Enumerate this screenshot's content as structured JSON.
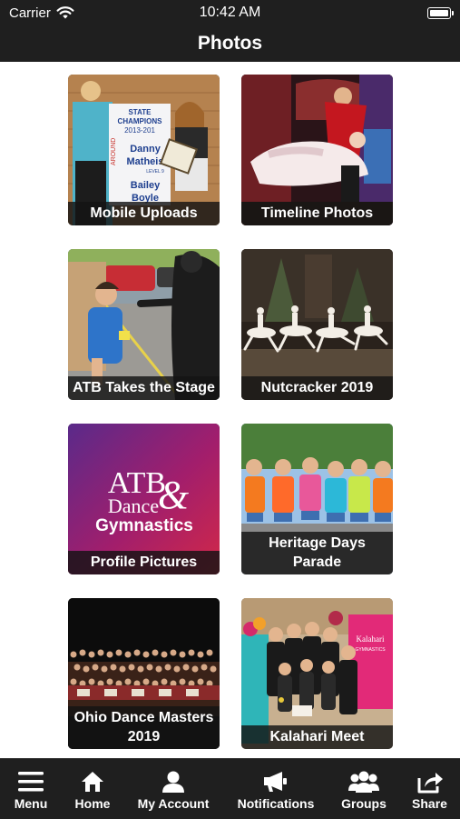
{
  "status_bar": {
    "carrier": "Carrier",
    "time": "10:42 AM",
    "wifi_icon": "wifi-icon",
    "battery_icon": "battery-icon"
  },
  "header": {
    "title": "Photos"
  },
  "albums": [
    {
      "caption": "Mobile Uploads",
      "sign_text": [
        "STATE",
        "CHAMPIONS",
        "2013-201",
        "Danny",
        "Matheis",
        "Bailey",
        "Boyle",
        "AROUND",
        "LEVEL 9"
      ]
    },
    {
      "caption": "Timeline Photos"
    },
    {
      "caption": "ATB Takes the Stage"
    },
    {
      "caption": "Nutcracker 2019"
    },
    {
      "caption": "Profile Pictures",
      "logo_text": [
        "ATB",
        "Dance",
        "Gymnastics"
      ]
    },
    {
      "caption": "Heritage Days Parade"
    },
    {
      "caption": "Ohio Dance Masters 2019"
    },
    {
      "caption": "Kalahari Meet",
      "banner_text": [
        "Kalahari",
        "GYMNASTICS"
      ]
    }
  ],
  "tab_bar": {
    "items": [
      {
        "label": "Menu",
        "icon": "menu-icon"
      },
      {
        "label": "Home",
        "icon": "home-icon"
      },
      {
        "label": "My Account",
        "icon": "account-icon"
      },
      {
        "label": "Notifications",
        "icon": "megaphone-icon"
      },
      {
        "label": "Groups",
        "icon": "groups-icon"
      },
      {
        "label": "Share",
        "icon": "share-icon"
      }
    ]
  }
}
